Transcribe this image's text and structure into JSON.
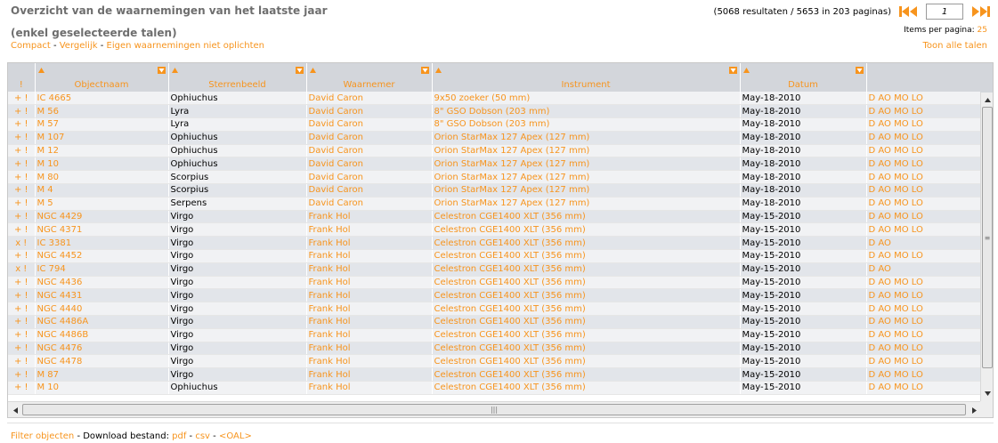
{
  "header": {
    "title": "Overzicht van de waarnemingen van het laatste jaar",
    "subtitle": "(enkel geselecteerde talen)",
    "links": [
      "Compact",
      "Vergelijk",
      "Eigen waarnemingen niet oplichten"
    ],
    "sep": "-",
    "toon_alle": "Toon alle talen"
  },
  "pager": {
    "summary": "(5068 resultaten / 5653 in 203 paginas)",
    "page": "1",
    "items_label": "Items per pagina:",
    "items_value": "25",
    "icons": [
      "first-page-icon",
      "prev-page-icon",
      "next-page-icon",
      "last-page-icon"
    ]
  },
  "table": {
    "columns": [
      "!",
      "Objectnaam",
      "Sterrenbeeld",
      "Waarnemer",
      "Instrument",
      "Datum",
      ""
    ],
    "rows": [
      {
        "flag": "+ !",
        "object": "IC 4665",
        "constellation": "Ophiuchus",
        "observer": "David Caron",
        "instrument": "9x50 zoeker  (50 mm)",
        "date": "May-18-2010",
        "langs": "D AO MO LO"
      },
      {
        "flag": "+ !",
        "object": "M 56",
        "constellation": "Lyra",
        "observer": "David Caron",
        "instrument": "8\" GSO Dobson  (203 mm)",
        "date": "May-18-2010",
        "langs": "D AO MO LO"
      },
      {
        "flag": "+ !",
        "object": "M 57",
        "constellation": "Lyra",
        "observer": "David Caron",
        "instrument": "8\" GSO Dobson  (203 mm)",
        "date": "May-18-2010",
        "langs": "D AO MO LO"
      },
      {
        "flag": "+ !",
        "object": "M 107",
        "constellation": "Ophiuchus",
        "observer": "David Caron",
        "instrument": "Orion StarMax 127 Apex  (127 mm)",
        "date": "May-18-2010",
        "langs": "D AO MO LO"
      },
      {
        "flag": "+ !",
        "object": "M 12",
        "constellation": "Ophiuchus",
        "observer": "David Caron",
        "instrument": "Orion StarMax 127 Apex  (127 mm)",
        "date": "May-18-2010",
        "langs": "D AO MO LO"
      },
      {
        "flag": "+ !",
        "object": "M 10",
        "constellation": "Ophiuchus",
        "observer": "David Caron",
        "instrument": "Orion StarMax 127 Apex  (127 mm)",
        "date": "May-18-2010",
        "langs": "D AO MO LO"
      },
      {
        "flag": "+ !",
        "object": "M 80",
        "constellation": "Scorpius",
        "observer": "David Caron",
        "instrument": "Orion StarMax 127 Apex  (127 mm)",
        "date": "May-18-2010",
        "langs": "D AO MO LO"
      },
      {
        "flag": "+ !",
        "object": "M 4",
        "constellation": "Scorpius",
        "observer": "David Caron",
        "instrument": "Orion StarMax 127 Apex  (127 mm)",
        "date": "May-18-2010",
        "langs": "D AO MO LO"
      },
      {
        "flag": "+ !",
        "object": "M 5",
        "constellation": "Serpens",
        "observer": "David Caron",
        "instrument": "Orion StarMax 127 Apex  (127 mm)",
        "date": "May-18-2010",
        "langs": "D AO MO LO"
      },
      {
        "flag": "+ !",
        "object": "NGC 4429",
        "constellation": "Virgo",
        "observer": "Frank Hol",
        "instrument": "Celestron CGE1400 XLT  (356 mm)",
        "date": "May-15-2010",
        "langs": "D AO MO LO"
      },
      {
        "flag": "+ !",
        "object": "NGC 4371",
        "constellation": "Virgo",
        "observer": "Frank Hol",
        "instrument": "Celestron CGE1400 XLT  (356 mm)",
        "date": "May-15-2010",
        "langs": "D AO MO LO"
      },
      {
        "flag": "x !",
        "object": "IC 3381",
        "constellation": "Virgo",
        "observer": "Frank Hol",
        "instrument": "Celestron CGE1400 XLT  (356 mm)",
        "date": "May-15-2010",
        "langs": "D AO"
      },
      {
        "flag": "+ !",
        "object": "NGC 4452",
        "constellation": "Virgo",
        "observer": "Frank Hol",
        "instrument": "Celestron CGE1400 XLT  (356 mm)",
        "date": "May-15-2010",
        "langs": "D AO MO LO"
      },
      {
        "flag": "x !",
        "object": "IC 794",
        "constellation": "Virgo",
        "observer": "Frank Hol",
        "instrument": "Celestron CGE1400 XLT  (356 mm)",
        "date": "May-15-2010",
        "langs": "D AO"
      },
      {
        "flag": "+ !",
        "object": "NGC 4436",
        "constellation": "Virgo",
        "observer": "Frank Hol",
        "instrument": "Celestron CGE1400 XLT  (356 mm)",
        "date": "May-15-2010",
        "langs": "D AO MO LO"
      },
      {
        "flag": "+ !",
        "object": "NGC 4431",
        "constellation": "Virgo",
        "observer": "Frank Hol",
        "instrument": "Celestron CGE1400 XLT  (356 mm)",
        "date": "May-15-2010",
        "langs": "D AO MO LO"
      },
      {
        "flag": "+ !",
        "object": "NGC 4440",
        "constellation": "Virgo",
        "observer": "Frank Hol",
        "instrument": "Celestron CGE1400 XLT  (356 mm)",
        "date": "May-15-2010",
        "langs": "D AO MO LO"
      },
      {
        "flag": "+ !",
        "object": "NGC 4486A",
        "constellation": "Virgo",
        "observer": "Frank Hol",
        "instrument": "Celestron CGE1400 XLT  (356 mm)",
        "date": "May-15-2010",
        "langs": "D AO MO LO"
      },
      {
        "flag": "+ !",
        "object": "NGC 4486B",
        "constellation": "Virgo",
        "observer": "Frank Hol",
        "instrument": "Celestron CGE1400 XLT  (356 mm)",
        "date": "May-15-2010",
        "langs": "D AO MO LO"
      },
      {
        "flag": "+ !",
        "object": "NGC 4476",
        "constellation": "Virgo",
        "observer": "Frank Hol",
        "instrument": "Celestron CGE1400 XLT  (356 mm)",
        "date": "May-15-2010",
        "langs": "D AO MO LO"
      },
      {
        "flag": "+ !",
        "object": "NGC 4478",
        "constellation": "Virgo",
        "observer": "Frank Hol",
        "instrument": "Celestron CGE1400 XLT  (356 mm)",
        "date": "May-15-2010",
        "langs": "D AO MO LO"
      },
      {
        "flag": "+ !",
        "object": "M 87",
        "constellation": "Virgo",
        "observer": "Frank Hol",
        "instrument": "Celestron CGE1400 XLT  (356 mm)",
        "date": "May-15-2010",
        "langs": "D AO MO LO"
      },
      {
        "flag": "+ !",
        "object": "M 10",
        "constellation": "Ophiuchus",
        "observer": "Frank Hol",
        "instrument": "Celestron CGE1400 XLT  (356 mm)",
        "date": "May-15-2010",
        "langs": "D AO MO LO"
      }
    ]
  },
  "scroll_icons": [
    "scroll-up-icon",
    "scroll-down-icon",
    "scroll-left-icon",
    "scroll-right-icon"
  ],
  "footer": {
    "filter": "Filter objecten",
    "sep": "-",
    "download_label": "Download bestand:",
    "pdf": "pdf",
    "csv": "csv",
    "oal": "<OAL>"
  },
  "colors": {
    "accent": "#f7941d",
    "header_bg": "#d3d6db",
    "row_light": "#f1f2f4",
    "row_dark": "#e2e5ea",
    "title_gray": "#6e6e6e"
  }
}
